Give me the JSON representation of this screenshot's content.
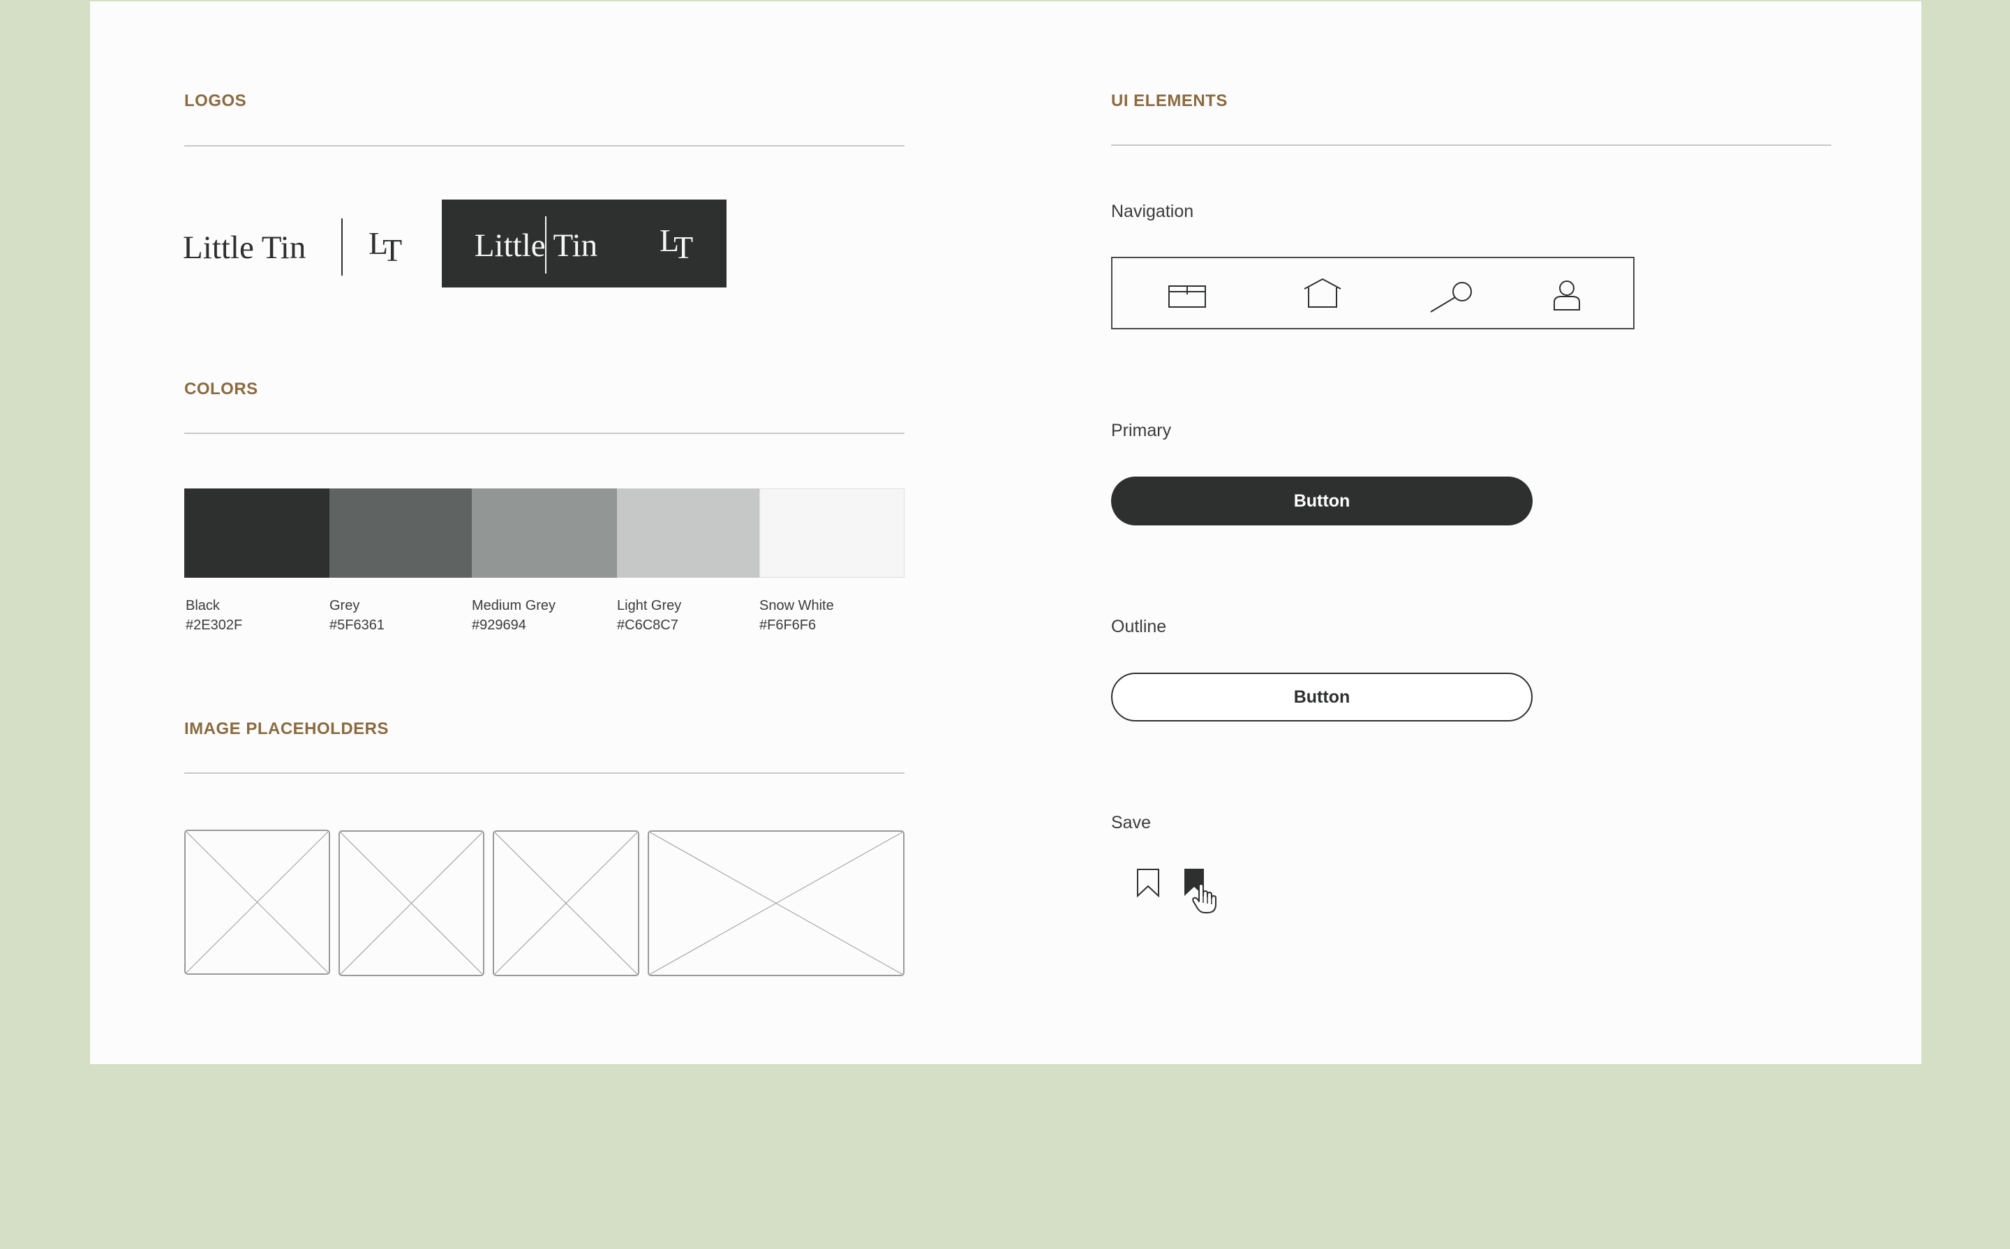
{
  "colors": {
    "background": "#D5DFC6",
    "sheet": "#FCFCFC",
    "accent": "#8B6A3E",
    "primary": "#2E302F"
  },
  "logos": {
    "title": "LOGOS",
    "wordmark": "Little Tin",
    "monogram_l": "L",
    "monogram_t": "T"
  },
  "colors_section": {
    "title": "COLORS",
    "swatches": [
      {
        "name": "Black",
        "hex": "#2E302F"
      },
      {
        "name": "Grey",
        "hex": "#5F6361"
      },
      {
        "name": "Medium Grey",
        "hex": "#929694"
      },
      {
        "name": "Light Grey",
        "hex": "#C6C8C7"
      },
      {
        "name": "Snow White",
        "hex": "#F6F6F6"
      }
    ]
  },
  "image_placeholders": {
    "title": "IMAGE PLACEHOLDERS"
  },
  "ui_elements": {
    "title": "UI ELEMENTS",
    "navigation_label": "Navigation",
    "nav_icons": [
      "box-icon",
      "home-icon",
      "search-icon",
      "user-icon"
    ],
    "primary_label": "Primary",
    "primary_button": "Button",
    "outline_label": "Outline",
    "outline_button": "Button",
    "save_label": "Save",
    "save_icons": [
      "bookmark-outline-icon",
      "bookmark-filled-icon",
      "hand-cursor-icon"
    ]
  }
}
